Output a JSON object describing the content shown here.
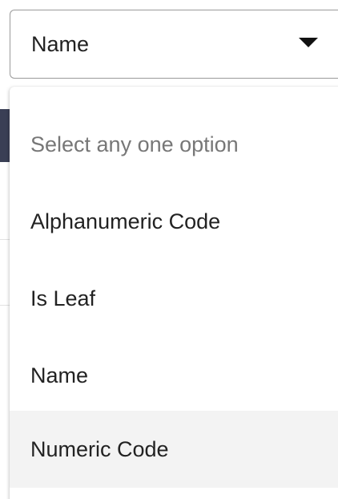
{
  "select": {
    "value": "Name"
  },
  "dropdown": {
    "placeholder": "Select any one option",
    "options": [
      {
        "label": "Alphanumeric Code"
      },
      {
        "label": "Is Leaf"
      },
      {
        "label": "Name"
      },
      {
        "label": "Numeric Code"
      }
    ],
    "hovered_option": "Numeric Code"
  },
  "colors": {
    "text": "#222222",
    "placeholder": "#777777",
    "hover_bg": "#f3f3f3",
    "border": "#9a9a9a"
  },
  "icons": {
    "caret": "chevron-down-icon"
  }
}
